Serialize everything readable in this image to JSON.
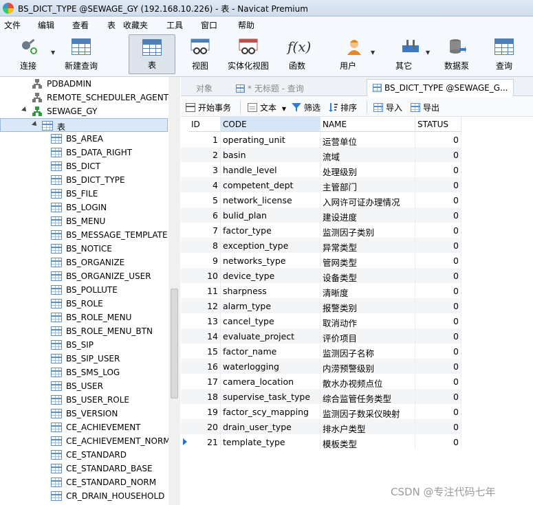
{
  "window": {
    "title": "BS_DICT_TYPE @SEWAGE_GY (192.168.10.226) - 表 - Navicat Premium"
  },
  "menu": [
    "文件",
    "编辑",
    "查看",
    "表",
    "收藏夹",
    "工具",
    "窗口",
    "帮助"
  ],
  "toolbar": {
    "connect": "连接",
    "new_query": "新建查询",
    "table": "表",
    "view": "视图",
    "materialized_view": "实体化视图",
    "function": "函数",
    "user": "用户",
    "other": "其它",
    "data_pump": "数据泵",
    "query": "查询"
  },
  "tree": {
    "servers": [
      "PDBADMIN",
      "REMOTE_SCHEDULER_AGENT",
      "SEWAGE_GY"
    ],
    "table_node": "表",
    "tables": [
      "BS_AREA",
      "BS_DATA_RIGHT",
      "BS_DICT",
      "BS_DICT_TYPE",
      "BS_FILE",
      "BS_LOGIN",
      "BS_MENU",
      "BS_MESSAGE_TEMPLATE",
      "BS_NOTICE",
      "BS_ORGANIZE",
      "BS_ORGANIZE_USER",
      "BS_POLLUTE",
      "BS_ROLE",
      "BS_ROLE_MENU",
      "BS_ROLE_MENU_BTN",
      "BS_SIP",
      "BS_SIP_USER",
      "BS_SMS_LOG",
      "BS_USER",
      "BS_USER_ROLE",
      "BS_VERSION",
      "CE_ACHIEVEMENT",
      "CE_ACHIEVEMENT_NORM",
      "CE_STANDARD",
      "CE_STANDARD_BASE",
      "CE_STANDARD_NORM",
      "CR_DRAIN_HOUSEHOLD"
    ]
  },
  "tabs": {
    "objects": "对象",
    "untitled_query": "* 无标题 - 查询",
    "active": "BS_DICT_TYPE @SEWAGE_G..."
  },
  "objbar": {
    "begin_transaction": "开始事务",
    "text": "文本",
    "filter": "筛选",
    "sort": "排序",
    "import": "导入",
    "export": "导出"
  },
  "grid": {
    "columns": [
      "ID",
      "CODE",
      "NAME",
      "STATUS"
    ],
    "rows": [
      [
        "1",
        "operating_unit",
        "运营单位",
        "0"
      ],
      [
        "2",
        "basin",
        "流域",
        "0"
      ],
      [
        "3",
        "handle_level",
        "处理级别",
        "0"
      ],
      [
        "4",
        "competent_dept",
        "主管部门",
        "0"
      ],
      [
        "5",
        "network_license",
        "入网许可证办理情况",
        "0"
      ],
      [
        "6",
        "bulid_plan",
        "建设进度",
        "0"
      ],
      [
        "7",
        "factor_type",
        "监测因子类别",
        "0"
      ],
      [
        "8",
        "exception_type",
        "异常类型",
        "0"
      ],
      [
        "9",
        "networks_type",
        "管网类型",
        "0"
      ],
      [
        "10",
        "device_type",
        "设备类型",
        "0"
      ],
      [
        "11",
        "sharpness",
        "清晰度",
        "0"
      ],
      [
        "12",
        "alarm_type",
        "报警类别",
        "0"
      ],
      [
        "13",
        "cancel_type",
        "取消动作",
        "0"
      ],
      [
        "14",
        "evaluate_project",
        "评价项目",
        "0"
      ],
      [
        "15",
        "factor_name",
        "监测因子名称",
        "0"
      ],
      [
        "16",
        "waterlogging",
        "内涝预警级别",
        "0"
      ],
      [
        "17",
        "camera_location",
        "散水办视频点位",
        "0"
      ],
      [
        "18",
        "supervise_task_type",
        "综合监管任务类型",
        "0"
      ],
      [
        "19",
        "factor_scy_mapping",
        "监测因子数采仪映射",
        "0"
      ],
      [
        "20",
        "drain_user_type",
        "排水户类型",
        "0"
      ],
      [
        "21",
        "template_type",
        "模板类型",
        "0"
      ]
    ]
  },
  "watermark": "CSDN @专注代码七年"
}
